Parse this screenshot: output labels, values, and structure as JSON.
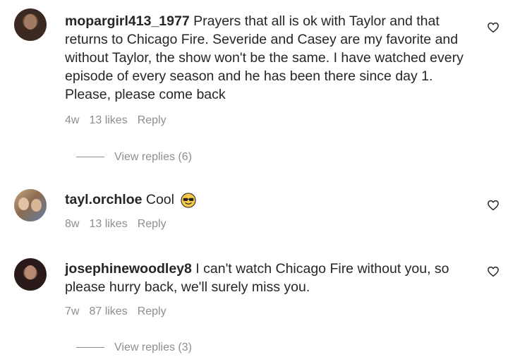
{
  "comments": [
    {
      "username": "mopargirl413_1977",
      "text": " Prayers that all is ok with Taylor and that returns to Chicago Fire. Severide and Casey are my favorite and without Taylor, the show won't be the same. I have watched every episode of every season and he has been there since day 1. Please, please come back",
      "age": "4w",
      "likes": "13 likes",
      "reply": "Reply",
      "view_replies": "View replies (6)"
    },
    {
      "username": "tayl.orchloe",
      "text": " Cool",
      "emoji": "sunglasses-emoji",
      "age": "8w",
      "likes": "13 likes",
      "reply": "Reply"
    },
    {
      "username": "josephinewoodley8",
      "text": " I can't watch Chicago Fire without you, so please hurry back, we'll surely miss you.",
      "age": "7w",
      "likes": "87 likes",
      "reply": "Reply",
      "view_replies": "View replies (3)"
    }
  ],
  "icons": {
    "like": "heart-outline-icon"
  },
  "colors": {
    "text": "#262626",
    "muted": "#8e8e8e",
    "background": "#ffffff"
  }
}
